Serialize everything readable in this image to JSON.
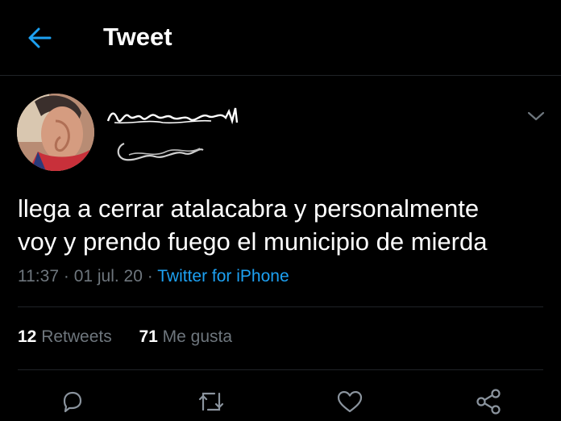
{
  "header": {
    "title": "Tweet",
    "back_icon": "arrow-left-icon",
    "accent": "#1da1f2"
  },
  "author": {
    "display_name_obscured": true,
    "handle_obscured": true
  },
  "tweet": {
    "text_line1": "llega a cerrar atalacabra y personalmente",
    "text_line2": "voy y prendo fuego el municipio de mierda",
    "time": "11:37",
    "date": "01 jul. 20",
    "separator": "·",
    "source": "Twitter for iPhone"
  },
  "stats": {
    "retweets_count": "12",
    "retweets_label": "Retweets",
    "likes_count": "71",
    "likes_label": "Me gusta"
  },
  "actions": [
    "reply-icon",
    "retweet-icon",
    "like-icon",
    "share-icon"
  ],
  "colors": {
    "background": "#000000",
    "muted": "#6e767d",
    "link": "#1da1f2",
    "divider": "#1f2327"
  }
}
